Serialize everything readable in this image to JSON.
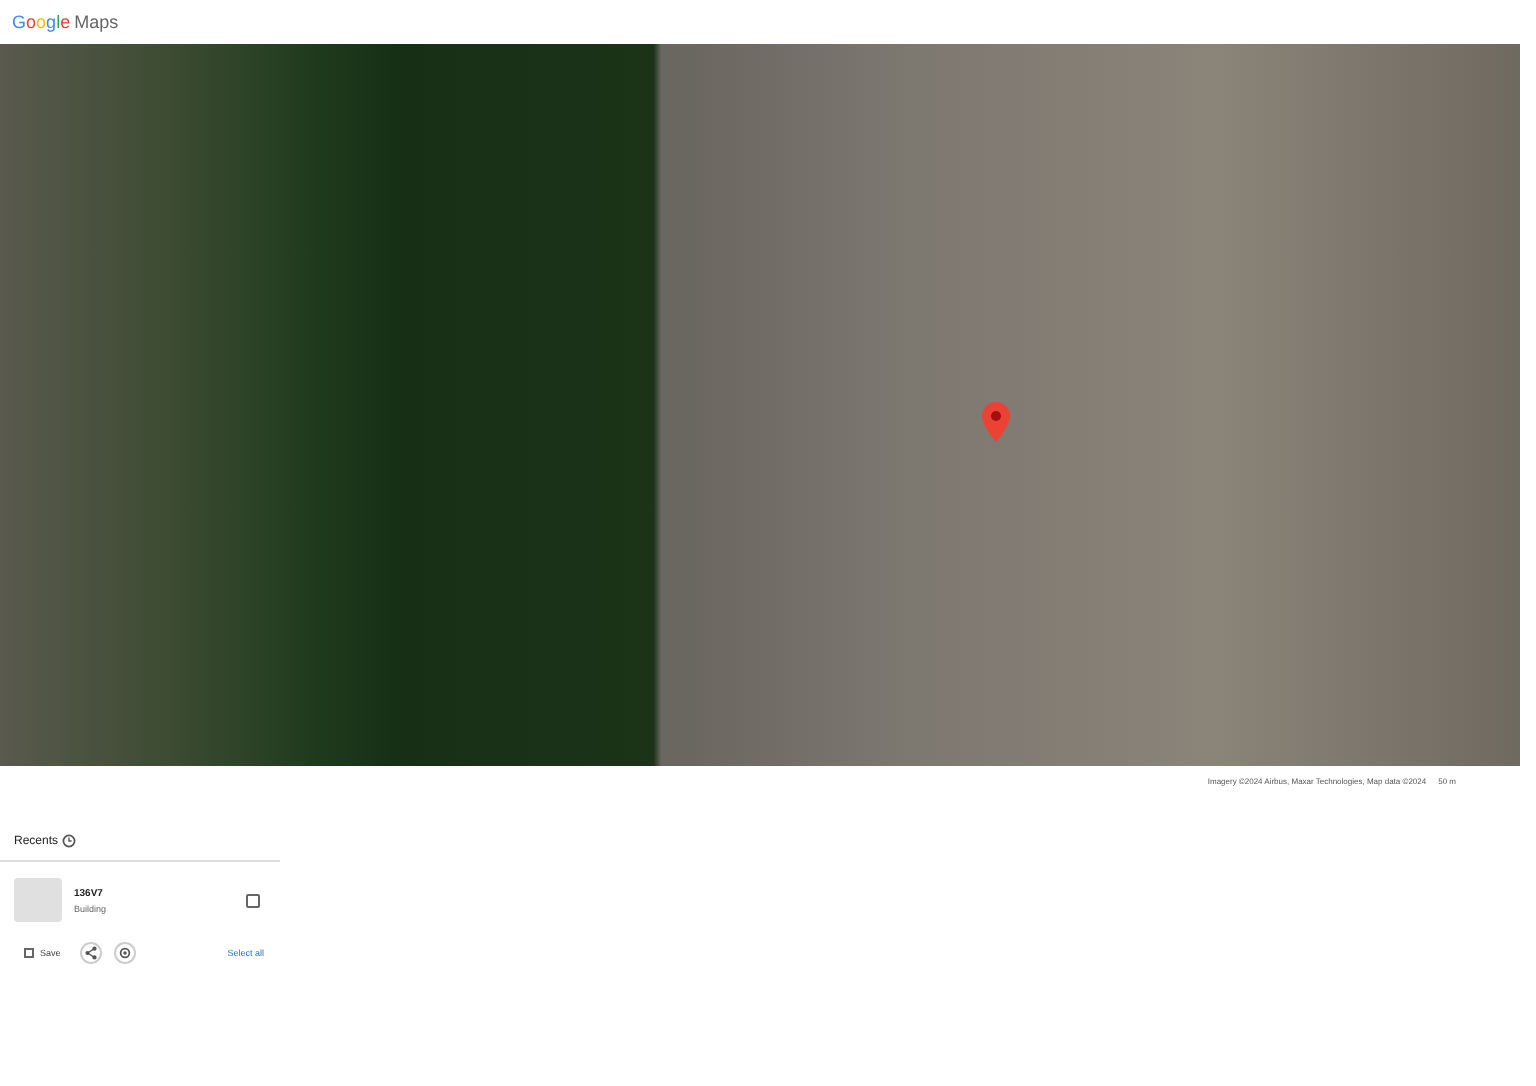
{
  "header": {
    "logo": "Google",
    "product": "Maps"
  },
  "map": {
    "attribution": "Imagery ©2024 Airbus, Maxar Technologies, Map data ©2024",
    "scale": "50 m"
  },
  "recents": {
    "title": "Recents",
    "items": [
      {
        "name": "136V7",
        "type": "Building",
        "checked": false
      }
    ],
    "save": "Save",
    "select_all": "Select all"
  }
}
